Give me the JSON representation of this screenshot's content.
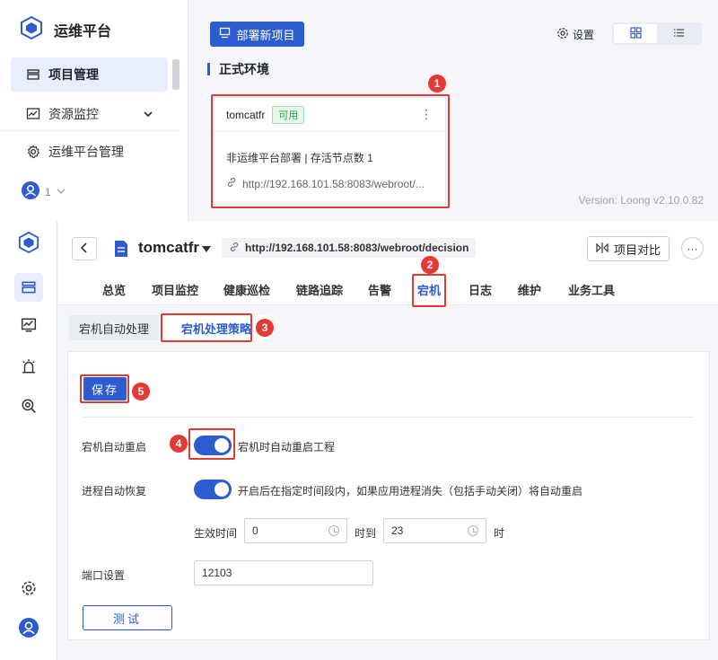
{
  "colors": {
    "primary": "#2c5cd0",
    "callout": "#e53935",
    "success": "#27a04a"
  },
  "top": {
    "brand": "运维平台",
    "sidebar": {
      "items": [
        {
          "label": "项目管理",
          "icon": "layers-icon",
          "active": true
        },
        {
          "label": "资源监控",
          "icon": "chart-icon",
          "expandable": true
        },
        {
          "label": "运维平台管理",
          "icon": "gear-icon"
        }
      ],
      "user_count": "1"
    },
    "deploy_button": "部署新项目",
    "settings_label": "设置",
    "env_title": "正式环境",
    "card": {
      "name": "tomcatfr",
      "status": "可用",
      "line1": "非运维平台部署  |  存活节点数 1",
      "url": "http://192.168.101.58:8083/webroot/..."
    },
    "version": "Version: Loong v2.10.0.82"
  },
  "detail": {
    "project_name": "tomcatfr",
    "url": "http://192.168.101.58:8083/webroot/decision",
    "compare_button": "项目对比",
    "tabs": [
      "总览",
      "项目监控",
      "健康巡检",
      "链路追踪",
      "告警",
      "宕机",
      "日志",
      "维护",
      "业务工具"
    ],
    "active_tab": "宕机",
    "subtabs": [
      "宕机自动处理",
      "宕机处理策略"
    ],
    "active_subtab": "宕机处理策略",
    "save_button": "保存",
    "auto_restart": {
      "label": "宕机自动重启",
      "enabled": true,
      "desc": "宕机时自动重启工程"
    },
    "process_recover": {
      "label": "进程自动恢复",
      "enabled": true,
      "desc": "开启后在指定时间段内，如果应用进程消失（包括手动关闭）将自动重启"
    },
    "time_range": {
      "label": "生效时间",
      "from": "0",
      "to_label": "时到",
      "to": "23",
      "unit": "时"
    },
    "port": {
      "label": "端口设置",
      "value": "12103"
    },
    "test_button": "测试"
  },
  "callouts": [
    "1",
    "2",
    "3",
    "4",
    "5"
  ]
}
